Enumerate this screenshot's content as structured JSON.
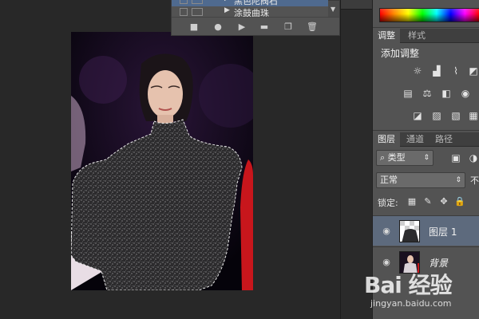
{
  "actions_panel": {
    "rows": [
      {
        "label": "黑色陀阀石",
        "selected": true
      },
      {
        "label": "涂鼓曲珠",
        "selected": false
      }
    ],
    "toolbar": [
      {
        "icon": "stop-icon",
        "glyph": "■"
      },
      {
        "icon": "record-icon",
        "glyph": "●"
      },
      {
        "icon": "play-icon",
        "glyph": "▶"
      },
      {
        "icon": "new-set-icon",
        "glyph": "▬"
      },
      {
        "icon": "new-action-icon",
        "glyph": "❐"
      },
      {
        "icon": "delete-icon",
        "glyph": "🗑"
      }
    ]
  },
  "adjustments": {
    "tabs": [
      "调整",
      "样式"
    ],
    "active_tab": "调整",
    "title": "添加调整",
    "icons": [
      {
        "name": "brightness-contrast-icon",
        "glyph": "☼"
      },
      {
        "name": "levels-icon",
        "glyph": "▟"
      },
      {
        "name": "curves-icon",
        "glyph": "⌇"
      },
      {
        "name": "exposure-icon",
        "glyph": "◩"
      },
      {
        "name": "vibrance-icon",
        "glyph": "▽"
      },
      {
        "name": "hue-saturation-icon",
        "glyph": "▤"
      },
      {
        "name": "color-balance-icon",
        "glyph": "⚖"
      },
      {
        "name": "black-white-icon",
        "glyph": "◧"
      },
      {
        "name": "photo-filter-icon",
        "glyph": "◉"
      },
      {
        "name": "channel-mixer-icon",
        "glyph": "⊕"
      },
      {
        "name": "invert-icon",
        "glyph": "◪"
      },
      {
        "name": "posterize-icon",
        "glyph": "▨"
      },
      {
        "name": "threshold-icon",
        "glyph": "▧"
      },
      {
        "name": "gradient-map-icon",
        "glyph": "▦"
      }
    ]
  },
  "layers": {
    "tabs": [
      "图层",
      "通道",
      "路径"
    ],
    "active_tab": "图层",
    "filter_kind": "类型",
    "blend_mode": "正常",
    "opacity_label": "不",
    "lock_label": "锁定:",
    "lock_icons": [
      {
        "name": "lock-transparent-icon",
        "glyph": "▦"
      },
      {
        "name": "lock-paint-icon",
        "glyph": "✎"
      },
      {
        "name": "lock-position-icon",
        "glyph": "✥"
      },
      {
        "name": "lock-all-icon",
        "glyph": "🔒"
      }
    ],
    "items": [
      {
        "name": "图层 1",
        "selected": true,
        "visible": true
      },
      {
        "name": "背景",
        "selected": false,
        "visible": true
      }
    ]
  },
  "watermark": {
    "logo": "Bai 经验",
    "url": "jingyan.baidu.com"
  },
  "colors": {
    "canvas_bg": "#282828",
    "panel_bg": "#535353",
    "selection": "#5d6a7d",
    "action_selection": "#4f6a8f"
  }
}
